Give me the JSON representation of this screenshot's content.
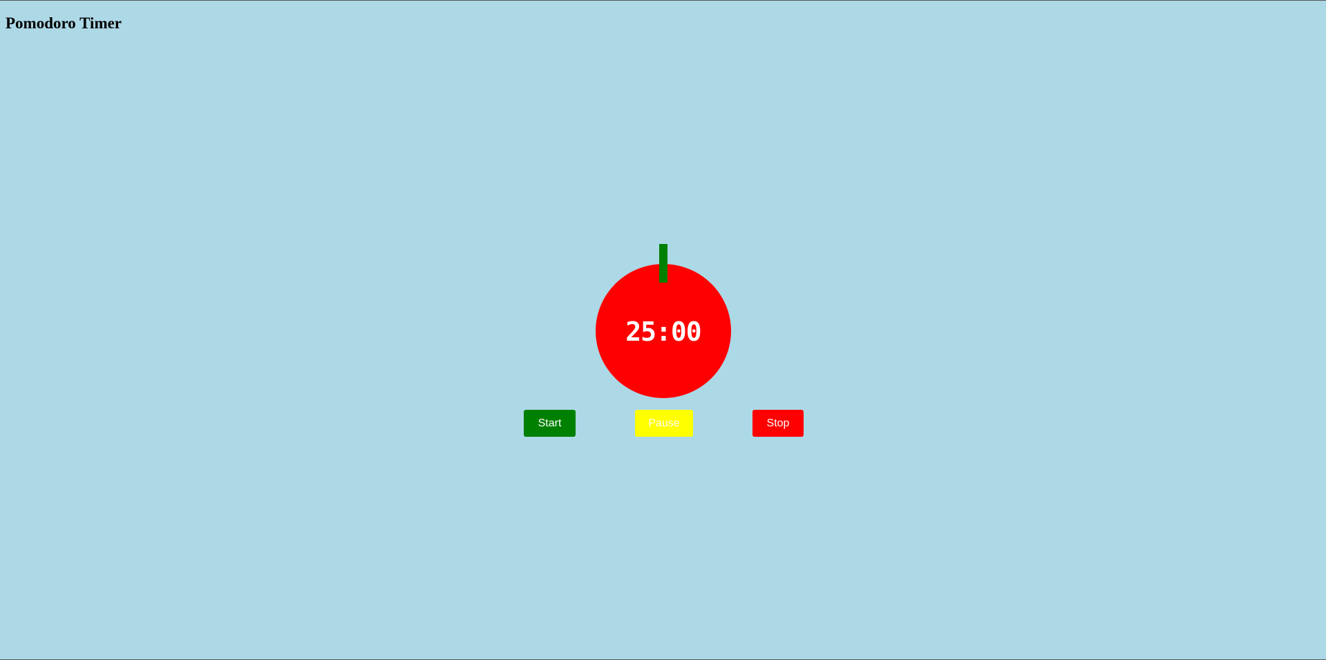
{
  "page": {
    "title": "Pomodoro Timer"
  },
  "timer": {
    "display": "25:00"
  },
  "controls": {
    "start_label": "Start",
    "pause_label": "Pause",
    "stop_label": "Stop"
  },
  "colors": {
    "background": "#add8e6",
    "tomato": "#ff0000",
    "stem": "#008000",
    "start_button": "#008000",
    "pause_button": "#ffff00",
    "stop_button": "#ff0000",
    "button_text": "#ffffff"
  }
}
